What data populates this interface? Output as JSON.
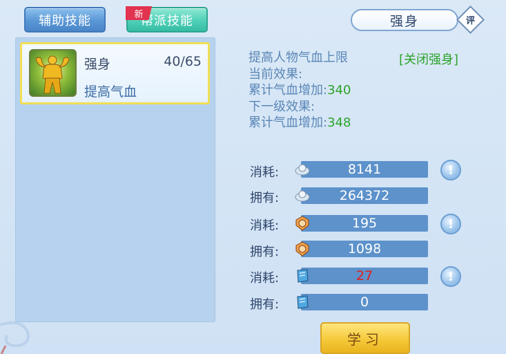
{
  "tabs": {
    "aux": "辅助技能",
    "guild": "帮派技能",
    "new_badge": "新"
  },
  "skill_list": [
    {
      "name": "强身",
      "level": "40/65",
      "desc": "提高气血",
      "icon": "muscle-figure-icon"
    }
  ],
  "detail": {
    "title": "强身",
    "rate_label": "评",
    "description": "提高人物气血上限",
    "close_link": "[关闭强身]",
    "current_label": "当前效果:",
    "current_effect_label": "累计气血增加:",
    "current_effect_value": "340",
    "next_label": "下一级效果:",
    "next_effect_label": "累计气血增加:",
    "next_effect_value": "348"
  },
  "resources": [
    {
      "label": "消耗:",
      "value": "8141",
      "icon": "silver-ingot-icon",
      "info": true,
      "highlight": false
    },
    {
      "label": "拥有:",
      "value": "264372",
      "icon": "silver-ingot-icon",
      "info": false,
      "highlight": false
    },
    {
      "label": "消耗:",
      "value": "195",
      "icon": "contribution-badge-icon",
      "info": true,
      "highlight": false
    },
    {
      "label": "拥有:",
      "value": "1098",
      "icon": "contribution-badge-icon",
      "info": false,
      "highlight": false
    },
    {
      "label": "消耗:",
      "value": "27",
      "icon": "skill-book-icon",
      "info": true,
      "highlight": true
    },
    {
      "label": "拥有:",
      "value": "0",
      "icon": "skill-book-icon",
      "info": false,
      "highlight": false
    }
  ],
  "info_button_glyph": "!",
  "study_button": "学习",
  "colors": {
    "accent_green": "#2aa32a",
    "insufficient_red": "#e1201c",
    "panel_blue": "#b7d2ee"
  }
}
